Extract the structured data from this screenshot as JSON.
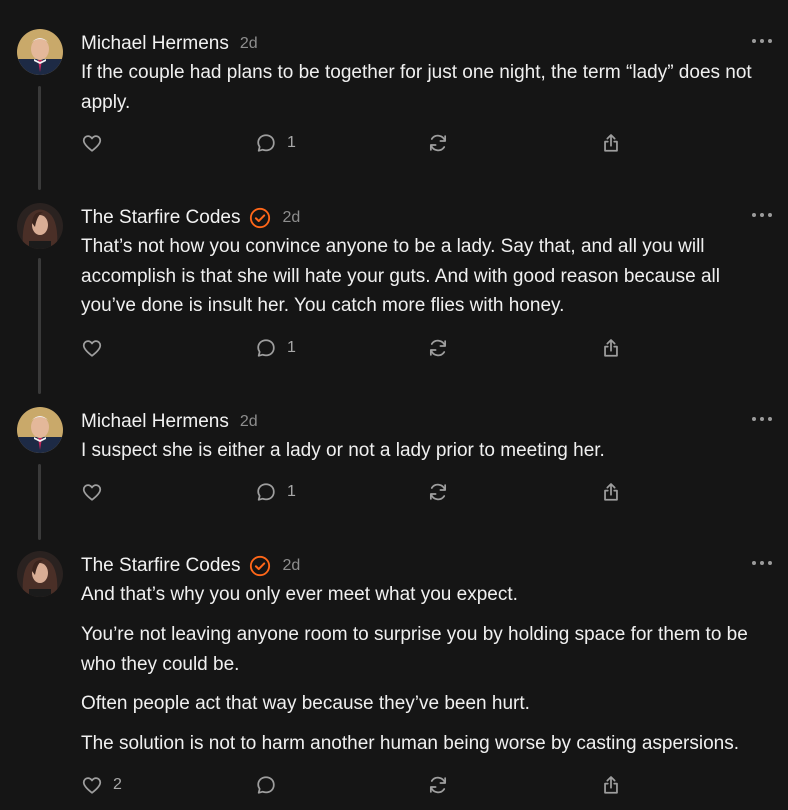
{
  "comments": [
    {
      "author": "Michael Hermens",
      "time": "2d",
      "verified": false,
      "paragraphs": [
        "If the couple had plans to be together for just one night, the term “lady” does not apply."
      ],
      "likes": "",
      "replies": "1"
    },
    {
      "author": "The Starfire Codes",
      "time": "2d",
      "verified": true,
      "paragraphs": [
        "That’s not how you convince anyone to be a lady. Say that, and all you will accomplish is that she will hate your guts. And with good reason because all you’ve done is insult her. You catch more flies with honey."
      ],
      "likes": "",
      "replies": "1"
    },
    {
      "author": "Michael Hermens",
      "time": "2d",
      "verified": false,
      "paragraphs": [
        "I suspect she is either a lady or not a lady prior to meeting her."
      ],
      "likes": "",
      "replies": "1"
    },
    {
      "author": "The Starfire Codes",
      "time": "2d",
      "verified": true,
      "paragraphs": [
        "And that’s why you only ever meet what you expect.",
        "You’re not leaving anyone room to surprise you by holding space for them to be who they could be.",
        "Often people act that way because they’ve been hurt.",
        "The solution is not to harm another human being worse by casting aspersions."
      ],
      "likes": "2",
      "replies": ""
    }
  ],
  "icons": {
    "like": "heart-icon",
    "reply": "comment-bubble-icon",
    "restack": "restack-icon",
    "share": "share-icon",
    "more": "more-dots-icon",
    "verified": "verified-badge-icon"
  },
  "colors": {
    "background": "#151515",
    "text": "#f0f0f0",
    "muted": "#8e8e8e",
    "verified": "#ff6719",
    "thread_line": "#3a3a3a"
  }
}
